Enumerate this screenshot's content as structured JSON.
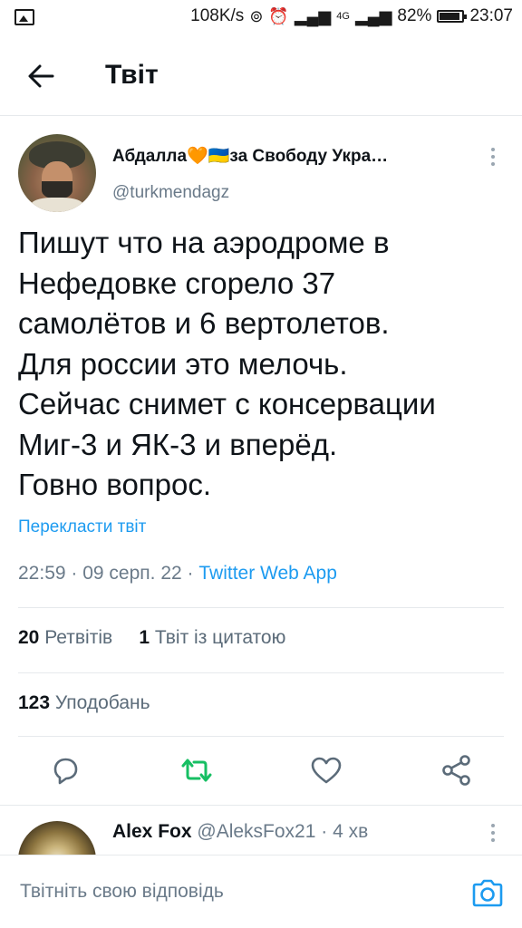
{
  "status_bar": {
    "speed": "108K/s",
    "network": "4G",
    "battery": "82%",
    "time": "23:07"
  },
  "header": {
    "title": "Твіт"
  },
  "tweet": {
    "author_name": "Абдалла🧡🇺🇦за Свободу Укра…",
    "author_handle": "@turkmendagz",
    "text": "Пишут что на аэродроме в\nНефедовке сгорело 37\nсамолётов и 6 вертолетов.\nДля россии это мелочь.\nСейчас снимет с консервации\nМиг-3 и ЯК-3 и вперёд.\nГовно вопрос.",
    "translate_link": "Перекласти твіт",
    "time": "22:59",
    "date": "09 серп. 22",
    "source": "Twitter Web App",
    "retweets_count": "20",
    "retweets_label": "Ретвітів",
    "quotes_count": "1",
    "quotes_label": "Твіт із цитатою",
    "likes_count": "123",
    "likes_label": "Уподобань"
  },
  "reply": {
    "author_name": "Alex Fox",
    "author_handle": "@AleksFox21",
    "time_ago": "4 хв"
  },
  "compose": {
    "placeholder": "Твітніть свою відповідь"
  },
  "colors": {
    "accent": "#1d9bf0",
    "retweet": "#17bf63",
    "text_secondary": "#6a7a89"
  },
  "icons": [
    "back-arrow-icon",
    "more-vertical-icon",
    "reply-icon",
    "retweet-icon",
    "like-icon",
    "share-icon",
    "camera-icon"
  ]
}
